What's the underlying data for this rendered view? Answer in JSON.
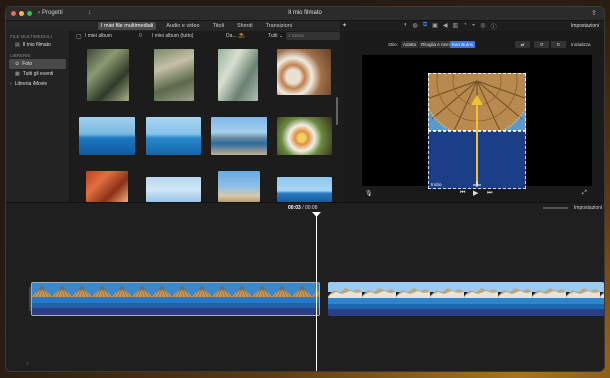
{
  "window": {
    "title": "Il mio filmato",
    "back_label": "Progetti"
  },
  "tabs": [
    {
      "label": "I miei file multimediali",
      "active": true
    },
    {
      "label": "Audio e video",
      "active": false
    },
    {
      "label": "Titoli",
      "active": false
    },
    {
      "label": "Sfondi",
      "active": false
    },
    {
      "label": "Transizioni",
      "active": false
    }
  ],
  "toolbar": {
    "settings_label": "Impostazioni",
    "adjust_icons": [
      "color-balance-icon",
      "color-correction-icon",
      "crop-icon",
      "stabilization-icon",
      "volume-icon",
      "equalizer-icon",
      "speed-icon",
      "noise-reduction-icon",
      "filters-icon",
      "info-icon"
    ]
  },
  "sidebar": {
    "section_media": "FILE MULTIMEDIALI",
    "project_item": "Il mio filmato",
    "section_libraries": "LIBRERIE",
    "items": [
      {
        "label": "Foto",
        "selected": true
      },
      {
        "label": "Tutti gli eventi",
        "selected": false
      },
      {
        "label": "Libreria iMovie",
        "selected": false
      }
    ]
  },
  "browser": {
    "album_label": "I miei album",
    "album_count": "0",
    "album_full_label": "I miei album (tutto)",
    "sort_label": "Da...",
    "filter_label": "Tutti",
    "search_placeholder": "Cerca"
  },
  "viewer": {
    "style_label": "Stile:",
    "style_options": [
      {
        "label": "Adatta",
        "selected": false
      },
      {
        "label": "Ritaglia e riempi",
        "selected": false
      },
      {
        "label": "Ken Burns",
        "selected": true
      }
    ],
    "settings_label": "Inizializza",
    "start_label": "Inizio",
    "end_label": "Fine"
  },
  "timeline": {
    "current_time": "00:03",
    "separator": "/",
    "total_time": "00:08",
    "settings_label": "Impostazioni"
  },
  "colors": {
    "accent": "#3b78e0",
    "selection": "#4a4a4a"
  }
}
